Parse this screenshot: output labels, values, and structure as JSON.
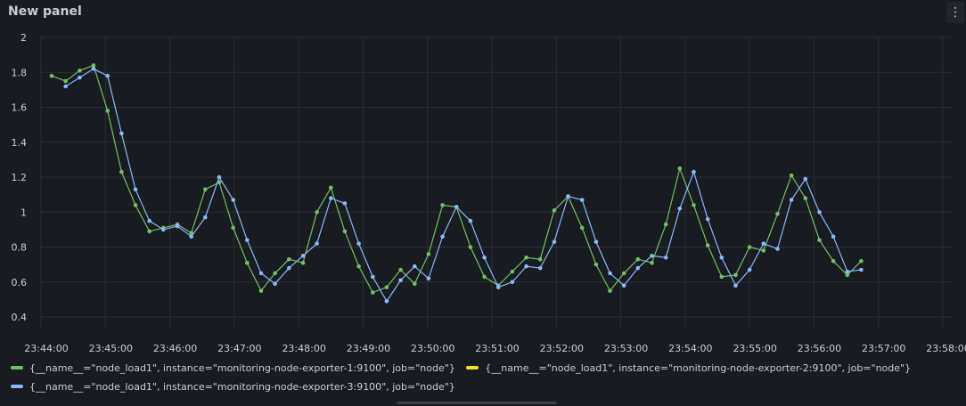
{
  "panel": {
    "title": "New panel",
    "menu_icon": "kebab-menu-icon"
  },
  "colors": {
    "green": "#73bf69",
    "yellow": "#fade2a",
    "blue": "#8ab8ff",
    "grid": "#2c2f35",
    "text": "#ccccdc"
  },
  "chart_data": {
    "type": "line",
    "title": "New panel",
    "xlabel": "",
    "ylabel": "",
    "ylim": [
      0.4,
      2
    ],
    "yticks": [
      "0.4",
      "0.6",
      "0.8",
      "1",
      "1.2",
      "1.4",
      "1.6",
      "1.8",
      "2"
    ],
    "xlim": [
      "23:44:00",
      "23:58:50"
    ],
    "xticks": [
      "23:44:00",
      "23:45:00",
      "23:46:00",
      "23:47:00",
      "23:48:00",
      "23:49:00",
      "23:50:00",
      "23:51:00",
      "23:52:00",
      "23:53:00",
      "23:54:00",
      "23:55:00",
      "23:56:00",
      "23:57:00",
      "23:58:00"
    ],
    "grid": true,
    "legend_position": "bottom",
    "series": [
      {
        "name": "{__name__=\"node_load1\", instance=\"monitoring-node-exporter-1:9100\", job=\"node\"}",
        "color": "#73bf69",
        "points": [
          [
            "23:44:10",
            1.78
          ],
          [
            "23:44:23",
            1.75
          ],
          [
            "23:44:36",
            1.81
          ],
          [
            "23:44:49",
            1.84
          ],
          [
            "23:45:02",
            1.58
          ],
          [
            "23:45:15",
            1.23
          ],
          [
            "23:45:28",
            1.04
          ],
          [
            "23:45:41",
            0.89
          ],
          [
            "23:45:54",
            0.91
          ],
          [
            "23:46:07",
            0.93
          ],
          [
            "23:46:20",
            0.88
          ],
          [
            "23:46:33",
            1.13
          ],
          [
            "23:46:46",
            1.17
          ],
          [
            "23:46:59",
            0.91
          ],
          [
            "23:47:12",
            0.71
          ],
          [
            "23:47:25",
            0.55
          ],
          [
            "23:47:38",
            0.65
          ],
          [
            "23:47:51",
            0.73
          ],
          [
            "23:48:04",
            0.71
          ],
          [
            "23:48:17",
            1.0
          ],
          [
            "23:48:30",
            1.14
          ],
          [
            "23:48:43",
            0.89
          ],
          [
            "23:48:56",
            0.69
          ],
          [
            "23:49:09",
            0.54
          ],
          [
            "23:49:22",
            0.57
          ],
          [
            "23:49:35",
            0.67
          ],
          [
            "23:49:48",
            0.59
          ],
          [
            "23:50:01",
            0.76
          ],
          [
            "23:50:14",
            1.04
          ],
          [
            "23:50:27",
            1.03
          ],
          [
            "23:50:40",
            0.8
          ],
          [
            "23:50:53",
            0.63
          ],
          [
            "23:51:06",
            0.58
          ],
          [
            "23:51:19",
            0.66
          ],
          [
            "23:51:32",
            0.74
          ],
          [
            "23:51:45",
            0.73
          ],
          [
            "23:51:58",
            1.01
          ],
          [
            "23:52:11",
            1.09
          ],
          [
            "23:52:24",
            0.91
          ],
          [
            "23:52:37",
            0.7
          ],
          [
            "23:52:50",
            0.55
          ],
          [
            "23:53:03",
            0.65
          ],
          [
            "23:53:16",
            0.73
          ],
          [
            "23:53:29",
            0.71
          ],
          [
            "23:53:42",
            0.93
          ],
          [
            "23:53:55",
            1.25
          ],
          [
            "23:54:08",
            1.04
          ],
          [
            "23:54:21",
            0.81
          ],
          [
            "23:54:34",
            0.63
          ],
          [
            "23:54:47",
            0.64
          ],
          [
            "23:55:00",
            0.8
          ],
          [
            "23:55:13",
            0.78
          ],
          [
            "23:55:26",
            0.99
          ],
          [
            "23:55:39",
            1.21
          ],
          [
            "23:55:52",
            1.08
          ],
          [
            "23:56:05",
            0.84
          ],
          [
            "23:56:18",
            0.72
          ],
          [
            "23:56:31",
            0.64
          ],
          [
            "23:56:44",
            0.72
          ]
        ]
      },
      {
        "name": "{__name__=\"node_load1\", instance=\"monitoring-node-exporter-2:9100\", job=\"node\"}",
        "color": "#fade2a",
        "points": []
      },
      {
        "name": "{__name__=\"node_load1\", instance=\"monitoring-node-exporter-3:9100\", job=\"node\"}",
        "color": "#8ab8ff",
        "points": [
          [
            "23:44:23",
            1.72
          ],
          [
            "23:44:36",
            1.77
          ],
          [
            "23:44:49",
            1.82
          ],
          [
            "23:45:02",
            1.78
          ],
          [
            "23:45:15",
            1.45
          ],
          [
            "23:45:28",
            1.13
          ],
          [
            "23:45:41",
            0.95
          ],
          [
            "23:45:54",
            0.9
          ],
          [
            "23:46:07",
            0.92
          ],
          [
            "23:46:20",
            0.86
          ],
          [
            "23:46:33",
            0.97
          ],
          [
            "23:46:46",
            1.2
          ],
          [
            "23:46:59",
            1.07
          ],
          [
            "23:47:12",
            0.84
          ],
          [
            "23:47:25",
            0.65
          ],
          [
            "23:47:38",
            0.59
          ],
          [
            "23:47:51",
            0.68
          ],
          [
            "23:48:04",
            0.75
          ],
          [
            "23:48:17",
            0.82
          ],
          [
            "23:48:30",
            1.08
          ],
          [
            "23:48:43",
            1.05
          ],
          [
            "23:48:56",
            0.82
          ],
          [
            "23:49:09",
            0.63
          ],
          [
            "23:49:22",
            0.49
          ],
          [
            "23:49:35",
            0.61
          ],
          [
            "23:49:48",
            0.69
          ],
          [
            "23:50:01",
            0.62
          ],
          [
            "23:50:14",
            0.86
          ],
          [
            "23:50:27",
            1.03
          ],
          [
            "23:50:40",
            0.95
          ],
          [
            "23:50:53",
            0.74
          ],
          [
            "23:51:06",
            0.57
          ],
          [
            "23:51:19",
            0.6
          ],
          [
            "23:51:32",
            0.69
          ],
          [
            "23:51:45",
            0.68
          ],
          [
            "23:51:58",
            0.83
          ],
          [
            "23:52:11",
            1.09
          ],
          [
            "23:52:24",
            1.07
          ],
          [
            "23:52:37",
            0.83
          ],
          [
            "23:52:50",
            0.65
          ],
          [
            "23:53:03",
            0.58
          ],
          [
            "23:53:16",
            0.68
          ],
          [
            "23:53:29",
            0.75
          ],
          [
            "23:53:42",
            0.74
          ],
          [
            "23:53:55",
            1.02
          ],
          [
            "23:54:08",
            1.23
          ],
          [
            "23:54:21",
            0.96
          ],
          [
            "23:54:34",
            0.74
          ],
          [
            "23:54:47",
            0.58
          ],
          [
            "23:55:00",
            0.67
          ],
          [
            "23:55:13",
            0.82
          ],
          [
            "23:55:26",
            0.79
          ],
          [
            "23:55:39",
            1.07
          ],
          [
            "23:55:52",
            1.19
          ],
          [
            "23:56:05",
            1.0
          ],
          [
            "23:56:18",
            0.86
          ],
          [
            "23:56:31",
            0.66
          ],
          [
            "23:56:44",
            0.67
          ]
        ]
      }
    ]
  }
}
